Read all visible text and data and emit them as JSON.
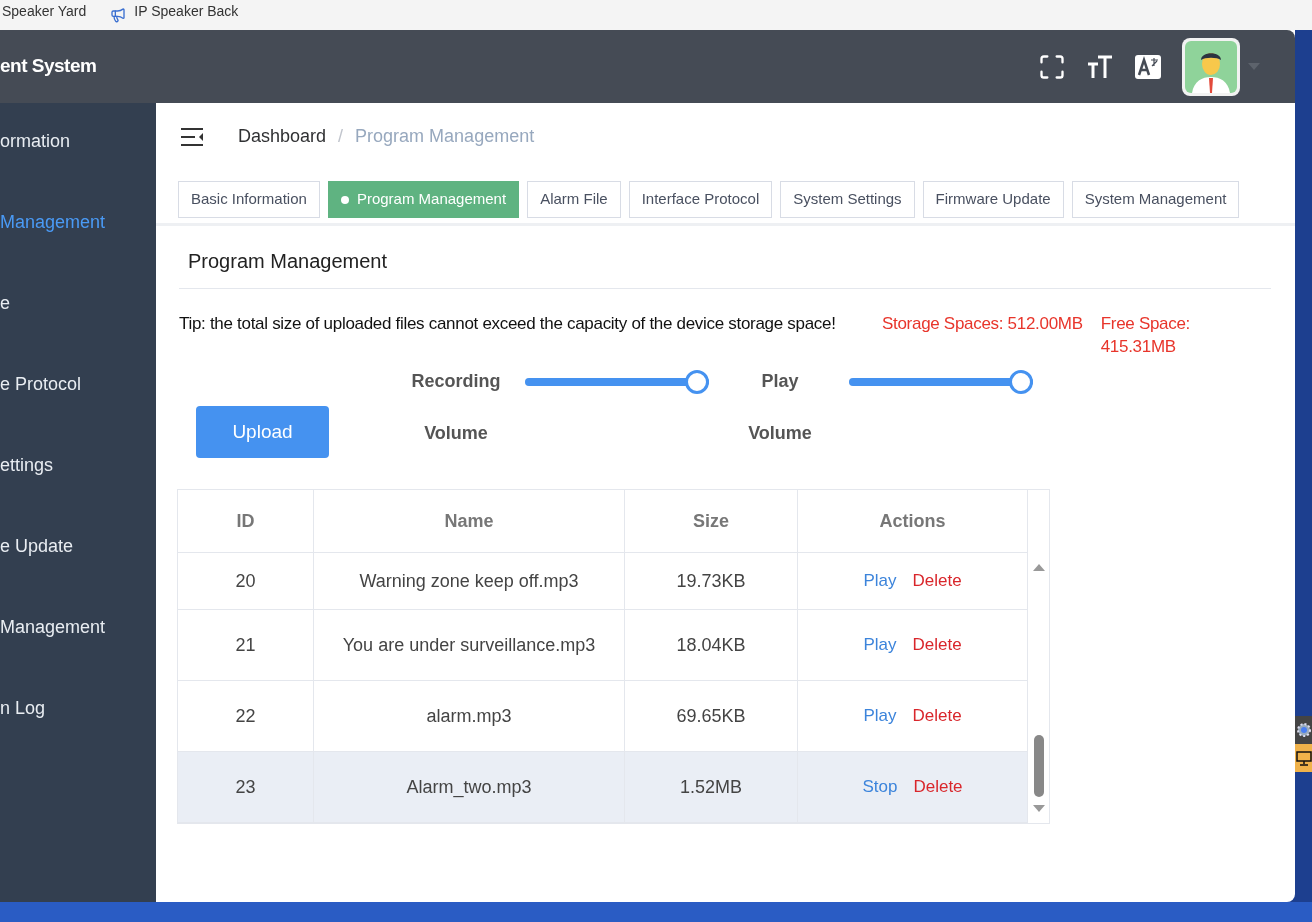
{
  "bookmarks": [
    "Speaker Yard",
    "IP Speaker Back"
  ],
  "header": {
    "title": "ent System"
  },
  "sidebar": {
    "items": [
      {
        "label": "ormation",
        "selected": false
      },
      {
        "label": "Management",
        "selected": true
      },
      {
        "label": "e",
        "selected": false
      },
      {
        "label": "e Protocol",
        "selected": false
      },
      {
        "label": "ettings",
        "selected": false
      },
      {
        "label": "e Update",
        "selected": false
      },
      {
        "label": "Management",
        "selected": false
      },
      {
        "label": "n Log",
        "selected": false
      }
    ]
  },
  "breadcrumb": [
    {
      "label": "Dashboard",
      "current": false
    },
    {
      "label": "Program Management",
      "current": true
    }
  ],
  "breadcrumb_separator": "/",
  "tabs": [
    {
      "label": "Basic Information",
      "selected": false
    },
    {
      "label": "Program Management",
      "selected": true
    },
    {
      "label": "Alarm File",
      "selected": false
    },
    {
      "label": "Interface Protocol",
      "selected": false
    },
    {
      "label": "System Settings",
      "selected": false
    },
    {
      "label": "Firmware Update",
      "selected": false
    },
    {
      "label": "System Management",
      "selected": false
    }
  ],
  "card": {
    "title": "Program Management",
    "tip": "Tip: the total size of uploaded files cannot exceed the capacity of the device storage space!",
    "storage": "Storage Spaces: 512.00MB",
    "free": "Free Space: 415.31MB",
    "upload_button": "Upload",
    "sliders": [
      {
        "label": "Recording Volume",
        "level": 1.0
      },
      {
        "label": "Play Volume",
        "level": 1.0
      }
    ]
  },
  "table": {
    "columns": [
      "ID",
      "Name",
      "Size",
      "Actions"
    ],
    "rows": [
      {
        "id": "20",
        "name": "Warning zone keep off.mp3",
        "size": "19.73KB",
        "action": "Play",
        "delete": "Delete",
        "selected": false
      },
      {
        "id": "21",
        "name": "You are under surveillance.mp3",
        "size": "18.04KB",
        "action": "Play",
        "delete": "Delete",
        "selected": false
      },
      {
        "id": "22",
        "name": "alarm.mp3",
        "size": "69.65KB",
        "action": "Play",
        "delete": "Delete",
        "selected": false
      },
      {
        "id": "23",
        "name": "Alarm_two.mp3",
        "size": "1.52MB",
        "action": "Stop",
        "delete": "Delete",
        "selected": true
      }
    ]
  }
}
